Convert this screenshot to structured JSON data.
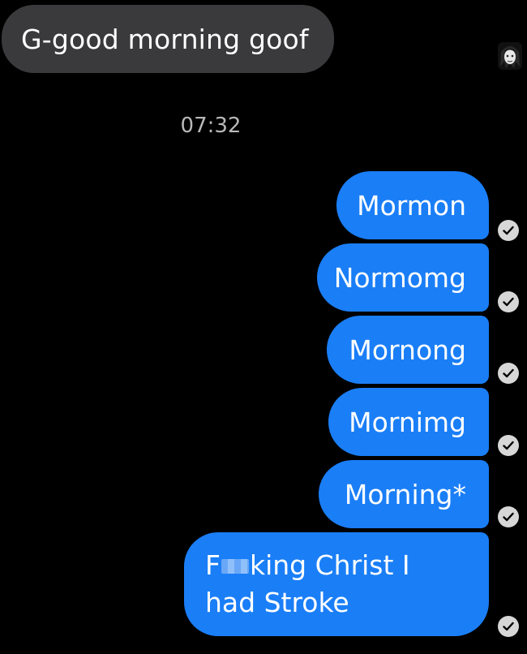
{
  "conversation": {
    "incoming_message": "G-good morning goof",
    "timestamp": "07:32",
    "outgoing_messages": [
      {
        "text": "Mormon",
        "status_icon": "read-check-icon"
      },
      {
        "text": "Normomg",
        "status_icon": "read-check-icon"
      },
      {
        "text": "Mornong",
        "status_icon": "read-check-icon"
      },
      {
        "text": "Mornimg",
        "status_icon": "read-check-icon"
      },
      {
        "text": "Morning*",
        "status_icon": "read-check-icon"
      },
      {
        "text_prefix": "F",
        "text_suffix": "king Christ I had Stroke",
        "censored": true,
        "status_icon": "read-check-icon"
      }
    ]
  },
  "colors": {
    "background": "#000000",
    "incoming_bubble": "#3a3a3c",
    "outgoing_bubble": "#1a7ef7",
    "timestamp": "#b8b8b8",
    "read_check": "#d7d7d7"
  }
}
